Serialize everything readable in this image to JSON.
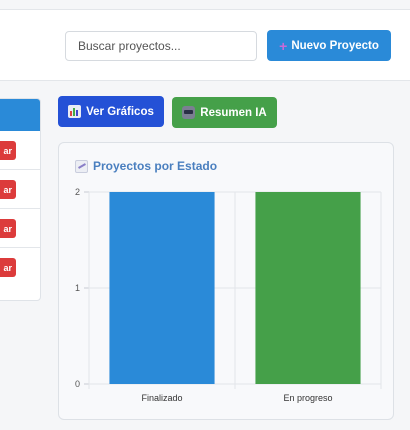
{
  "header": {
    "search_placeholder": "Buscar proyectos...",
    "new_project_label": "Nuevo Proyecto",
    "new_project_icon": "plus-icon"
  },
  "side_table": {
    "row_button_fragment": "ar",
    "rows": 4
  },
  "actions": {
    "charts_label": "Ver Gráficos",
    "charts_icon": "bar-chart-icon",
    "ai_label": "Resumen IA",
    "ai_icon": "robot-icon"
  },
  "card": {
    "title": "Proyectos por Estado",
    "title_icon": "line-chart-icon"
  },
  "colors": {
    "primary": "#2a8ad8",
    "charts_button": "#2451d6",
    "ai_button": "#45a049",
    "danger": "#dc3b3b",
    "title": "#4a7fbf"
  },
  "chart_data": {
    "type": "bar",
    "title": "",
    "categories": [
      "Finalizado",
      "En progreso"
    ],
    "values": [
      2,
      2
    ],
    "colors": [
      "#2a8ad8",
      "#45a049"
    ],
    "ylim": [
      0,
      2
    ],
    "yticks": [
      0,
      1,
      2
    ],
    "xlabel": "",
    "ylabel": "",
    "grid": true
  }
}
